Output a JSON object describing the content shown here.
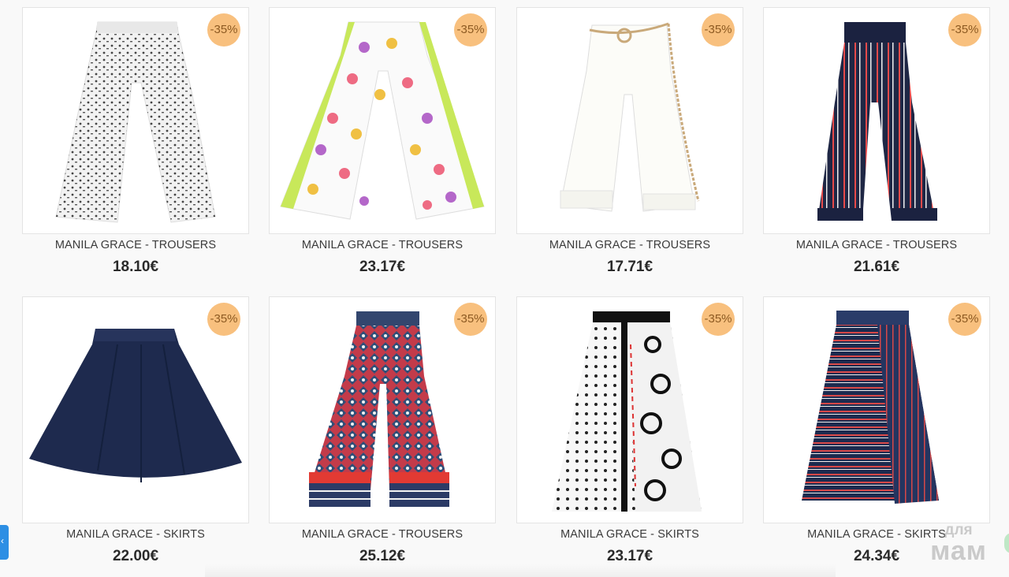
{
  "products": [
    {
      "name": "MANILA GRACE - TROUSERS",
      "price": "18.10€",
      "discount": "-35%",
      "image": "polka-dot-trousers"
    },
    {
      "name": "MANILA GRACE - TROUSERS",
      "price": "23.17€",
      "discount": "-35%",
      "image": "floral-wide-trousers"
    },
    {
      "name": "MANILA GRACE - TROUSERS",
      "price": "17.71€",
      "discount": "-35%",
      "image": "white-belted-trousers"
    },
    {
      "name": "MANILA GRACE - TROUSERS",
      "price": "21.61€",
      "discount": "-35%",
      "image": "navy-striped-trousers"
    },
    {
      "name": "MANILA GRACE - SKIRTS",
      "price": "22.00€",
      "discount": "-35%",
      "image": "navy-pleated-skirt"
    },
    {
      "name": "MANILA GRACE - TROUSERS",
      "price": "25.12€",
      "discount": "-35%",
      "image": "geometric-print-trousers"
    },
    {
      "name": "MANILA GRACE - SKIRTS",
      "price": "23.17€",
      "discount": "-35%",
      "image": "black-white-pleated-skirt"
    },
    {
      "name": "MANILA GRACE - SKIRTS",
      "price": "24.34€",
      "discount": "-35%",
      "image": "striped-pleated-skirt"
    }
  ],
  "watermark": {
    "line1": "для",
    "line2": "мам"
  },
  "side_tab": {
    "icon": "chevron-left-icon",
    "glyph": "‹"
  },
  "colors": {
    "badge": "#f8c07e",
    "badge_text": "#8d5a22",
    "side_tab": "#2d8fe4"
  }
}
